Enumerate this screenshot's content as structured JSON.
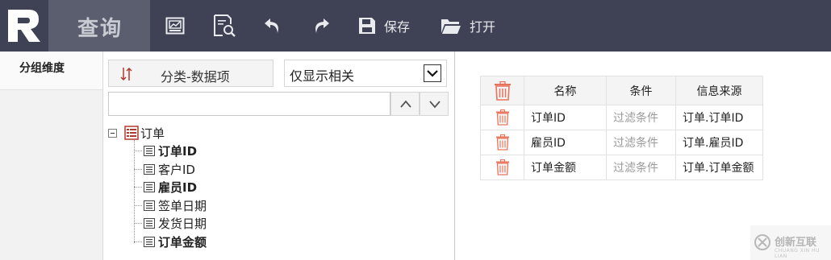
{
  "header": {
    "brand_icon": "r-logo-icon",
    "app_title": "查询",
    "toolbar": {
      "chart_icon": "chart-icon",
      "preview_icon": "search-document-icon",
      "undo_icon": "undo-icon",
      "redo_icon": "redo-icon",
      "save_label": "保存",
      "open_label": "打开"
    }
  },
  "leftnav": {
    "tab_label": "分组维度"
  },
  "fieldpanel": {
    "sort_button_label": "分类-数据项",
    "filter_select_value": "仅显示相关",
    "search_value": "",
    "tree": {
      "root_label": "订单",
      "items": [
        {
          "label": "订单ID",
          "bold": true
        },
        {
          "label": "客户ID",
          "bold": false
        },
        {
          "label": "雇员ID",
          "bold": true
        },
        {
          "label": "签单日期",
          "bold": false
        },
        {
          "label": "发货日期",
          "bold": false
        },
        {
          "label": "订单金额",
          "bold": true
        }
      ]
    }
  },
  "conditions": {
    "headers": {
      "name": "名称",
      "condition": "条件",
      "source": "信息来源"
    },
    "rows": [
      {
        "name": "订单ID",
        "condition": "过滤条件",
        "source": "订单.订单ID"
      },
      {
        "name": "雇员ID",
        "condition": "过滤条件",
        "source": "订单.雇员ID"
      },
      {
        "name": "订单金额",
        "condition": "过滤条件",
        "source": "订单.订单金额"
      }
    ]
  },
  "watermark": {
    "text": "创新互联",
    "sub": "CHUANG XIN HU LIAN"
  },
  "colors": {
    "topbar": "#3f4254",
    "active_tab": "#5b5e6e",
    "trash_red": "#e8735a",
    "tree_icon_red": "#b03a2e"
  }
}
